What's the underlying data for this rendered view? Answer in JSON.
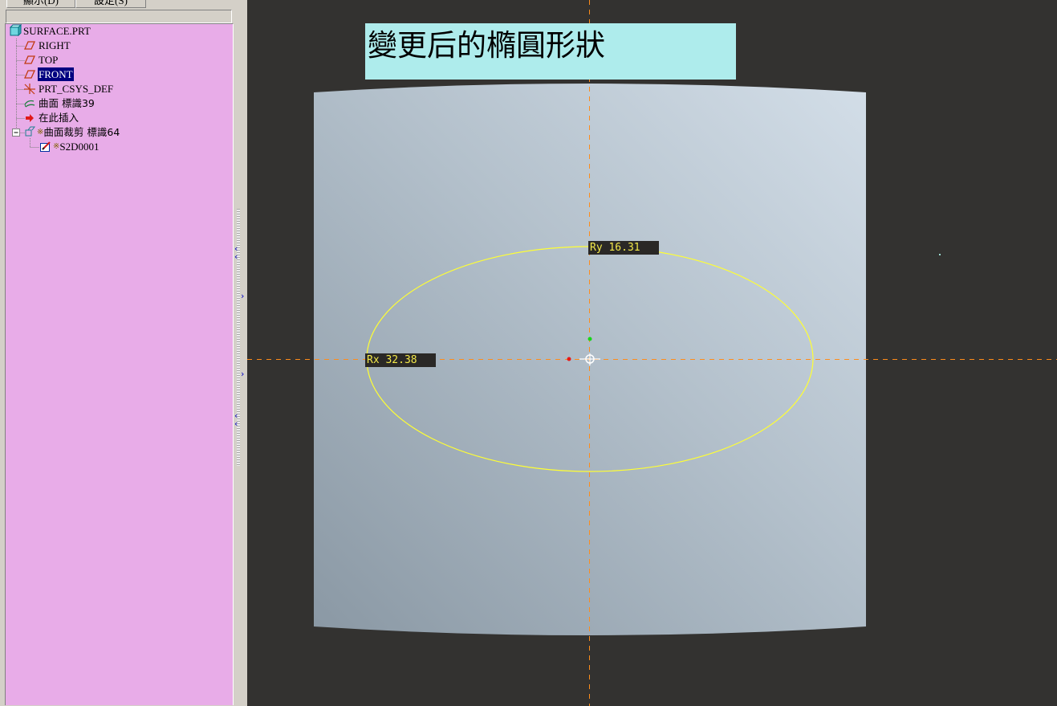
{
  "tabs": [
    {
      "label": "顯示(D)"
    },
    {
      "label": "設定(S)"
    }
  ],
  "model_tree": {
    "root": {
      "label": "SURFACE.PRT",
      "icon": "part-icon"
    },
    "items": [
      {
        "label": "RIGHT",
        "icon": "datum-plane-icon"
      },
      {
        "label": "TOP",
        "icon": "datum-plane-icon"
      },
      {
        "label": "FRONT",
        "icon": "datum-plane-icon",
        "selected": true
      },
      {
        "label": "PRT_CSYS_DEF",
        "icon": "coordinate-system-icon"
      },
      {
        "label": "曲面 標識39",
        "icon": "surface-icon"
      },
      {
        "label": "在此插入",
        "icon": "insert-here-arrow-icon"
      },
      {
        "label": "曲面裁剪 標識64",
        "icon": "surface-trim-icon",
        "marker": "※"
      },
      {
        "label": "S2D0001",
        "icon": "sketch-icon",
        "marker": "※"
      }
    ],
    "background_color": "#e8ace8",
    "selection_color": "#000080"
  },
  "viewport": {
    "annotation": "變更后的橢圓形狀",
    "annotation_bg": "#aeecec",
    "background_color": "#333230",
    "surface_color_light": "#d0dbe4",
    "surface_color_dark": "#8a98a4",
    "ellipse_color": "#ffff33",
    "centerline_color": "#ff8c1a",
    "dimensions": {
      "ry": "Ry 16.31",
      "rx": "Rx 32.38"
    }
  },
  "colors": {
    "panel": "#d4d0c8",
    "dimension_text": "#f2e84a",
    "dimension_bg": "#2a2826"
  }
}
